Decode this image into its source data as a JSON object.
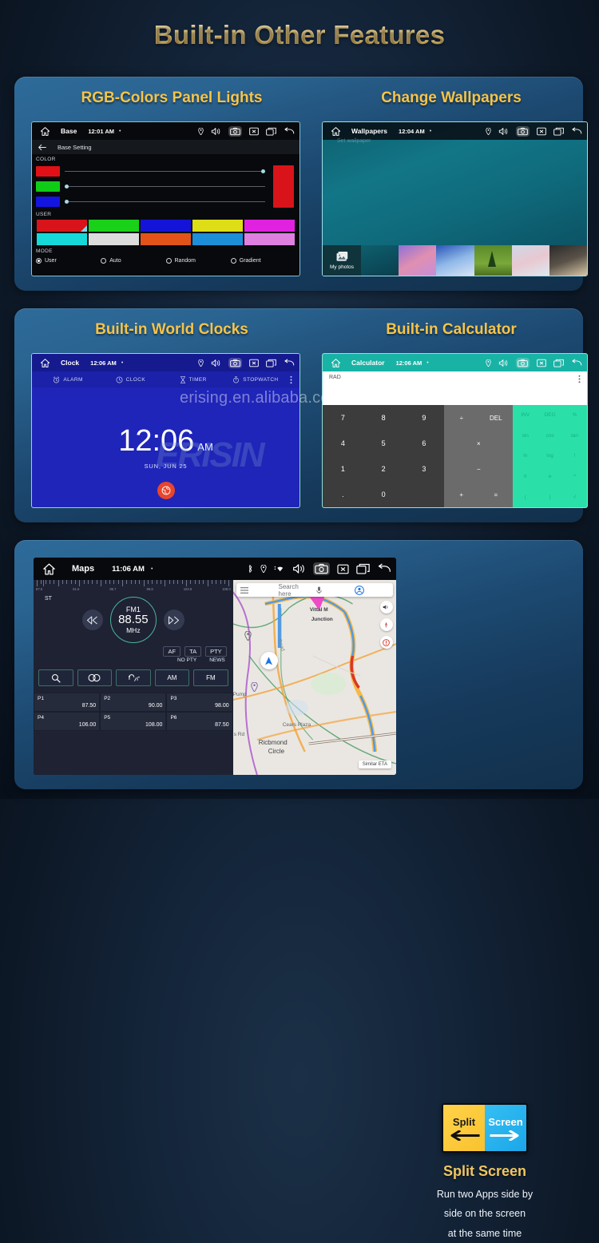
{
  "header": {
    "title": "Built-in Other Features"
  },
  "watermark": {
    "text": "erising.en.alibaba.com",
    "logo": "ERISIN"
  },
  "panels": {
    "rgb": {
      "title": "RGB-Colors Panel Lights",
      "statusbar": {
        "app": "Base",
        "time": "12:01 AM",
        "dot": "•"
      },
      "subheader": "Base Setting",
      "color_label": "COLOR",
      "user_label": "USER",
      "mode_label": "MODE",
      "sliders": [
        {
          "name": "red",
          "chip": "#e01016",
          "value": 98
        },
        {
          "name": "green",
          "chip": "#11cc16",
          "value": 0
        },
        {
          "name": "blue",
          "chip": "#1414e0",
          "value": 0
        }
      ],
      "preview_color": "#d8141a",
      "swatches_row1": [
        "#d8141a",
        "#19d119",
        "#1414d8",
        "#dede16",
        "#e022e0"
      ],
      "swatches_row2": [
        "#16d8d8",
        "#dcdcdc",
        "#e2531a",
        "#1c8fd8",
        "#df7fdf"
      ],
      "modes": [
        {
          "label": "User",
          "selected": true
        },
        {
          "label": "Auto",
          "selected": false
        },
        {
          "label": "Random",
          "selected": false
        },
        {
          "label": "Gradient",
          "selected": false
        }
      ]
    },
    "wallpapers": {
      "title": "Change Wallpapers",
      "statusbar": {
        "app": "Wallpapers",
        "time": "12:04 AM",
        "dot": "•"
      },
      "ghost_text": "Set wallpaper",
      "my_photos": "My photos",
      "thumbs": [
        "linear-gradient(160deg,#0e5f6e,#0a3f4e)",
        "linear-gradient(150deg,#8f6fd8,#e08fb0,#c58fd8)",
        "linear-gradient(160deg,#2a55b8,#8fb8e8,#d8e4f5)",
        "linear-gradient(180deg,#5a8a2a 0%,#7aa83a 60%,#4a7020 100%)",
        "linear-gradient(160deg,#cfd8e8,#e8c8d0,#dfe8f0)",
        "linear-gradient(160deg,#2a2a2a,#5a5248,#d8c8a8)"
      ]
    },
    "clock": {
      "title": "Built-in World Clocks",
      "statusbar": {
        "app": "Clock",
        "time": "12:06 AM",
        "dot": "•"
      },
      "tabs": [
        "ALARM",
        "CLOCK",
        "TIMER",
        "STOPWATCH"
      ],
      "time": "12:06",
      "ampm": "AM",
      "date": "SUN, JUN 25"
    },
    "calculator": {
      "title": "Built-in Calculator",
      "statusbar": {
        "app": "Calculator",
        "time": "12:06 AM",
        "dot": "•"
      },
      "mode": "RAD",
      "numeric_keys": [
        "7",
        "8",
        "9",
        "4",
        "5",
        "6",
        "1",
        "2",
        "3",
        ".",
        "0"
      ],
      "operator_keys": [
        "÷",
        "DEL",
        "×",
        "−",
        "+",
        "="
      ],
      "scientific_keys": [
        "INV",
        "DEG",
        "%",
        "sin",
        "cos",
        "tan",
        "ln",
        "log",
        "!",
        "π",
        "e",
        "^",
        "(",
        ")",
        "√"
      ]
    },
    "split": {
      "statusbar": {
        "app": "Maps",
        "time": "11:06 AM",
        "dot": "•"
      },
      "radio": {
        "stereo": "ST",
        "band": "FM1",
        "frequency": "88.55",
        "unit": "MHz",
        "scale_labels": [
          "87.5",
          "91.6",
          "95.7",
          "99.8",
          "103.9",
          "108.0"
        ],
        "rds_buttons": [
          "AF",
          "TA",
          "PTY"
        ],
        "rds_sub": [
          "NO PTY",
          "NEWS"
        ],
        "controls": [
          "search-icon",
          "stereo-icon",
          "loc-icon",
          "AM",
          "FM"
        ],
        "control_labels": [
          "",
          "",
          "",
          "AM",
          "FM"
        ],
        "presets": [
          {
            "key": "P1",
            "value": "87.50"
          },
          {
            "key": "P2",
            "value": "90.00"
          },
          {
            "key": "P3",
            "value": "98.00"
          },
          {
            "key": "P4",
            "value": "106.00"
          },
          {
            "key": "P5",
            "value": "108.00"
          },
          {
            "key": "P6",
            "value": "87.50"
          }
        ]
      },
      "map": {
        "search_placeholder": "Search here",
        "eta": "Similar ETA",
        "labels": [
          "Vittal M",
          "Junction",
          "Cears Plaza",
          "Ricbmond",
          "Circle",
          "s Rd",
          "Pump",
          "Road"
        ]
      },
      "promo": {
        "tile_left": "Split",
        "tile_right": "Screen",
        "heading": "Split Screen",
        "line1": "Run two Apps side by",
        "line2": "side on the screen",
        "line3": "at the same time"
      }
    }
  }
}
